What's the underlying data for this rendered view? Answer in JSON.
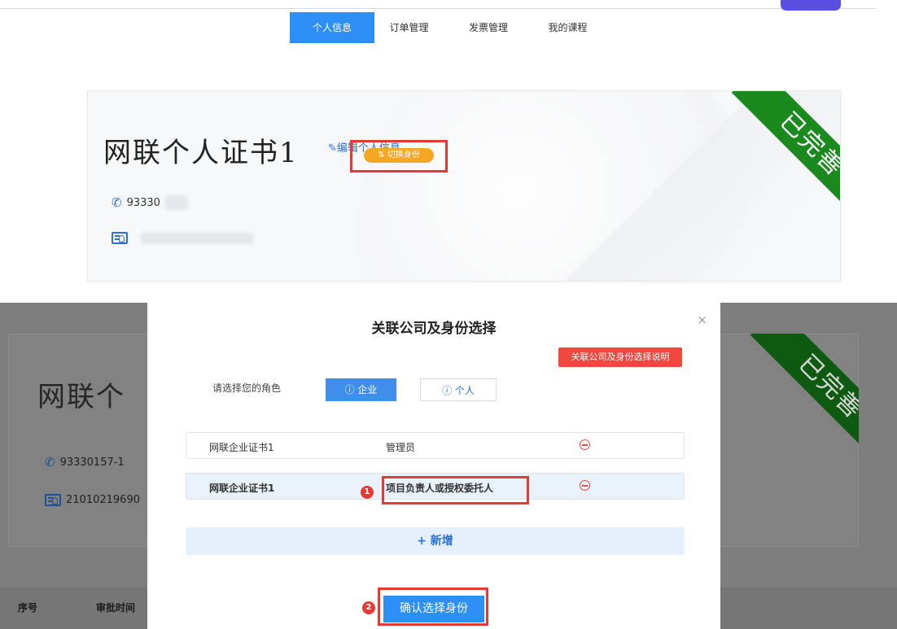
{
  "nav": {
    "tabs": [
      "个人信息",
      "订单管理",
      "发票管理",
      "我的课程"
    ],
    "active_index": 0
  },
  "profile_card": {
    "name": "网联个人证书1",
    "edit_link": "编辑个人信息",
    "switch_identity_button": "切换身份",
    "status_ribbon": "已完善",
    "phone_partial": "93330"
  },
  "background": {
    "name_partial": "网联个",
    "phone": "93330157-1",
    "id_number_partial": "21010219690",
    "status_ribbon": "已完善",
    "table_headers": [
      "序号",
      "审批时间"
    ]
  },
  "modal": {
    "title": "关联公司及身份选择",
    "close": "×",
    "explain_button": "关联公司及身份选择说明",
    "role_label": "请选择您的角色",
    "role_options": [
      "企业",
      "个人"
    ],
    "selected_role": "企业",
    "rows": [
      {
        "company": "网联企业证书1",
        "role": "管理员"
      },
      {
        "company": "网联企业证书1",
        "role": "项目负责人或授权委托人"
      }
    ],
    "add_button": "+ 新增",
    "confirm_button": "确认选择身份"
  },
  "annotations": {
    "step1": "1",
    "step2": "2"
  },
  "colors": {
    "primary": "#2b8ff6",
    "ribbon_green": "#1a8a1f",
    "switch_orange": "#f5a623",
    "danger_red": "#f0483e",
    "annotation_red": "#e53935"
  }
}
